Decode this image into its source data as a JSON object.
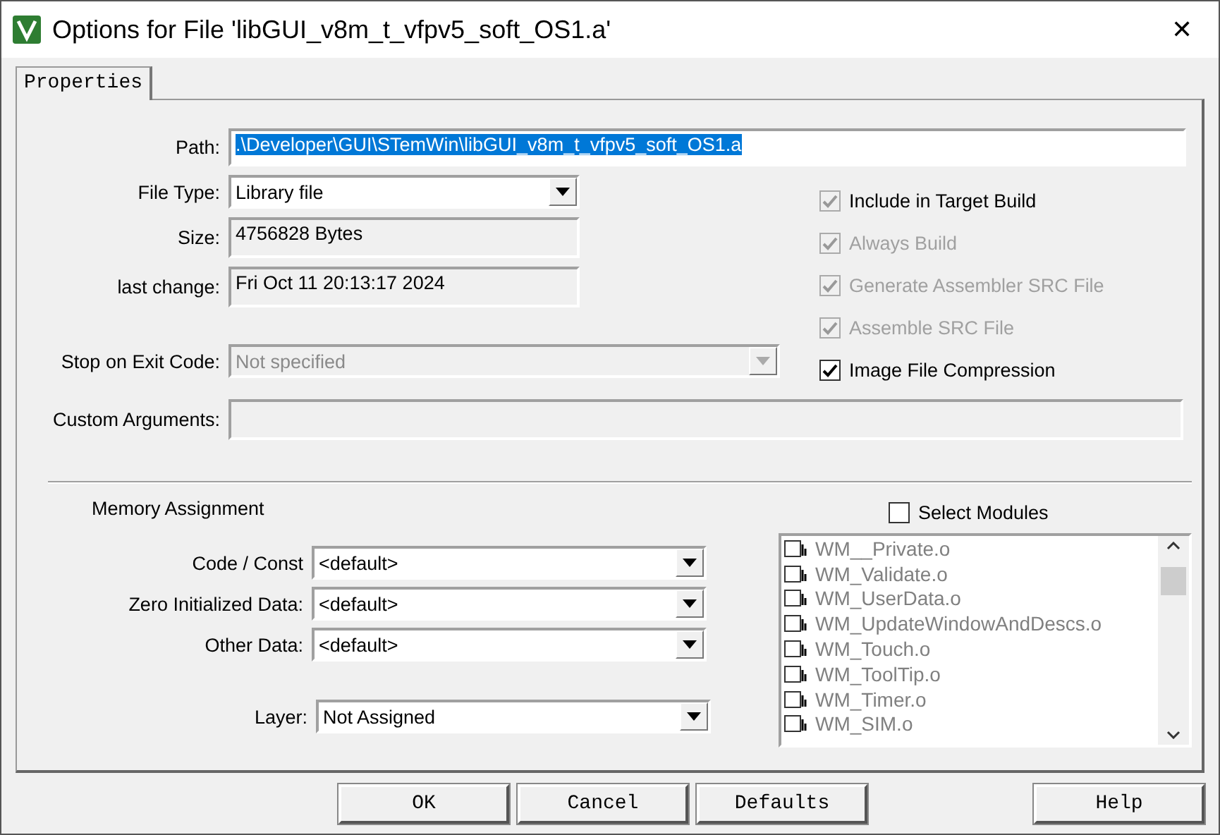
{
  "window": {
    "title": "Options for File 'libGUI_v8m_t_vfpv5_soft_OS1.a'",
    "close": "✕"
  },
  "tabs": [
    {
      "label": "Properties",
      "selected": true
    }
  ],
  "path": {
    "label": "Path:",
    "value": ".\\Developer\\GUI\\STemWin\\libGUI_v8m_t_vfpv5_soft_OS1.a"
  },
  "fields": [
    {
      "kind": "combo",
      "label": "File Type:",
      "value": "Library file",
      "disabled": false
    },
    {
      "kind": "readonly",
      "label": "Size:",
      "value": "4756828 Bytes"
    },
    {
      "kind": "readonly",
      "label": "last change:",
      "value": "Fri Oct 11 20:13:17 2024"
    },
    {
      "kind": "combo",
      "label": "Stop on Exit Code:",
      "value": "Not specified",
      "disabled": true
    }
  ],
  "options": [
    {
      "label": "Include in Target Build",
      "checked": true,
      "disabled": false,
      "box_disabled": true
    },
    {
      "label": "Always Build",
      "checked": true,
      "disabled": true,
      "box_disabled": true
    },
    {
      "label": "Generate Assembler SRC File",
      "checked": true,
      "disabled": true,
      "box_disabled": true
    },
    {
      "label": "Assemble SRC File",
      "checked": true,
      "disabled": true,
      "box_disabled": true
    },
    {
      "label": "Image File Compression",
      "checked": true,
      "disabled": false,
      "box_disabled": false
    }
  ],
  "custom_arguments": {
    "label": "Custom Arguments:"
  },
  "memory": {
    "title": "Memory Assignment",
    "rows": [
      {
        "label": "Code / Const",
        "value": "<default>"
      },
      {
        "label": "Zero Initialized Data:",
        "value": "<default>"
      },
      {
        "label": "Other Data:",
        "value": "<default>"
      }
    ],
    "layer": {
      "label": "Layer:",
      "value": "Not Assigned"
    }
  },
  "modules": {
    "select": {
      "label": "Select Modules",
      "checked": false
    },
    "items": [
      {
        "label": "WM__Private.o"
      },
      {
        "label": "WM_Validate.o"
      },
      {
        "label": "WM_UserData.o"
      },
      {
        "label": "WM_UpdateWindowAndDescs.o"
      },
      {
        "label": "WM_Touch.o"
      },
      {
        "label": "WM_ToolTip.o"
      },
      {
        "label": "WM_Timer.o"
      },
      {
        "label": "WM_SIM.o"
      }
    ]
  },
  "buttons": [
    {
      "label": "OK",
      "kind": "left"
    },
    {
      "label": "Cancel",
      "kind": "left"
    },
    {
      "label": "Defaults",
      "kind": "left"
    },
    {
      "label": "Help",
      "kind": "right"
    }
  ]
}
